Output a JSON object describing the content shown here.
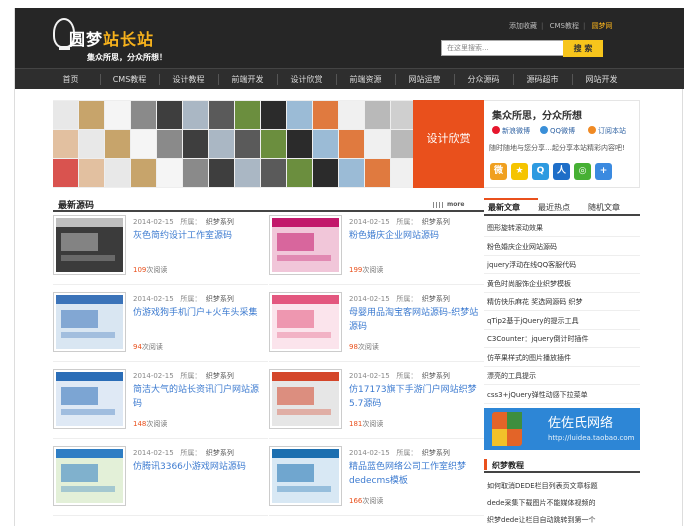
{
  "logo": {
    "title_part1": "圆梦",
    "title_part2": "站长站",
    "slogan": "集众所思，分众所想！"
  },
  "toplinks": {
    "add_fav": "添加收藏",
    "cms": "CMS教程",
    "yuanmeng": "圆梦网"
  },
  "search": {
    "placeholder": "在这里搜索...",
    "button": "搜 索"
  },
  "nav": [
    "首页",
    "CMS教程",
    "设计教程",
    "前端开发",
    "设计欣赏",
    "前端资源",
    "网站运营",
    "分众源码",
    "源码超市",
    "网站开发"
  ],
  "banner": {
    "label": "设计欣赏"
  },
  "sidebox": {
    "title": "集众所思，分众所想",
    "links": [
      "新浪微博",
      "QQ微博",
      "订阅本站"
    ],
    "note": "随时随地与您分享…起分享本站精彩内容吧!",
    "share_icons": [
      "sina-share-icon",
      "qzone-share-icon",
      "tencent-share-icon",
      "renren-share-icon",
      "wechat-share-icon",
      "more-share-icon"
    ]
  },
  "section": {
    "title": "最新源码",
    "more": "more"
  },
  "cards": [
    {
      "date": "2014-02-15",
      "cat_label": "所属：",
      "cat": "织梦系列",
      "title": "灰色简约设计工作室源码",
      "reads": "109",
      "reads_label": "次阅读"
    },
    {
      "date": "2014-02-15",
      "cat_label": "所属：",
      "cat": "织梦系列",
      "title": "粉色婚庆企业网站源码",
      "reads": "199",
      "reads_label": "次阅读"
    },
    {
      "date": "2014-02-15",
      "cat_label": "所属：",
      "cat": "织梦系列",
      "title": "仿游戏狗手机门户+火车头采集",
      "reads": "94",
      "reads_label": "次阅读"
    },
    {
      "date": "2014-02-15",
      "cat_label": "所属：",
      "cat": "织梦系列",
      "title": "母婴用品淘宝客网站源码-织梦站源码",
      "reads": "98",
      "reads_label": "次阅读"
    },
    {
      "date": "2014-02-15",
      "cat_label": "所属：",
      "cat": "织梦系列",
      "title": "简洁大气的站长资讯门户网站源码",
      "reads": "148",
      "reads_label": "次阅读"
    },
    {
      "date": "2014-02-15",
      "cat_label": "所属：",
      "cat": "织梦系列",
      "title": "仿17173旗下手游门户网站织梦5.7源码",
      "reads": "181",
      "reads_label": "次阅读"
    },
    {
      "date": "2014-02-15",
      "cat_label": "所属：",
      "cat": "织梦系列",
      "title": "仿腾讯3366小游戏网站源码",
      "reads": "",
      "reads_label": ""
    },
    {
      "date": "2014-02-15",
      "cat_label": "所属：",
      "cat": "织梦系列",
      "title": "精品蓝色网络公司工作室织梦dedecms模板",
      "reads": "166",
      "reads_label": "次阅读"
    }
  ],
  "tabs": [
    "最新文章",
    "最近热点",
    "随机文章"
  ],
  "recent": [
    "图形旋转滚动效果",
    "粉色婚庆企业网站源码",
    "jquery浮动在线QQ客服代码",
    "黄色时尚服饰企业织梦模板",
    "精仿快乐麻花 奖选网源码 织梦",
    "qTip2基于jQuery的提示工具",
    "C3Counter：jquery倒计时插件",
    "仿苹果样式的图片播放插件",
    "漂亮的工具提示",
    "css3+jQuery弹性动感下拉菜单"
  ],
  "ad": {
    "title": "佐佐氏网络",
    "url": "http://luidea.taobao.com"
  },
  "dede": {
    "title": "织梦教程",
    "items": [
      "如何取消DEDE栏目列表页文章标题",
      "dede采集下载图片不能媒体视频的",
      "织梦dede让栏目自动跳转到第一个"
    ]
  }
}
